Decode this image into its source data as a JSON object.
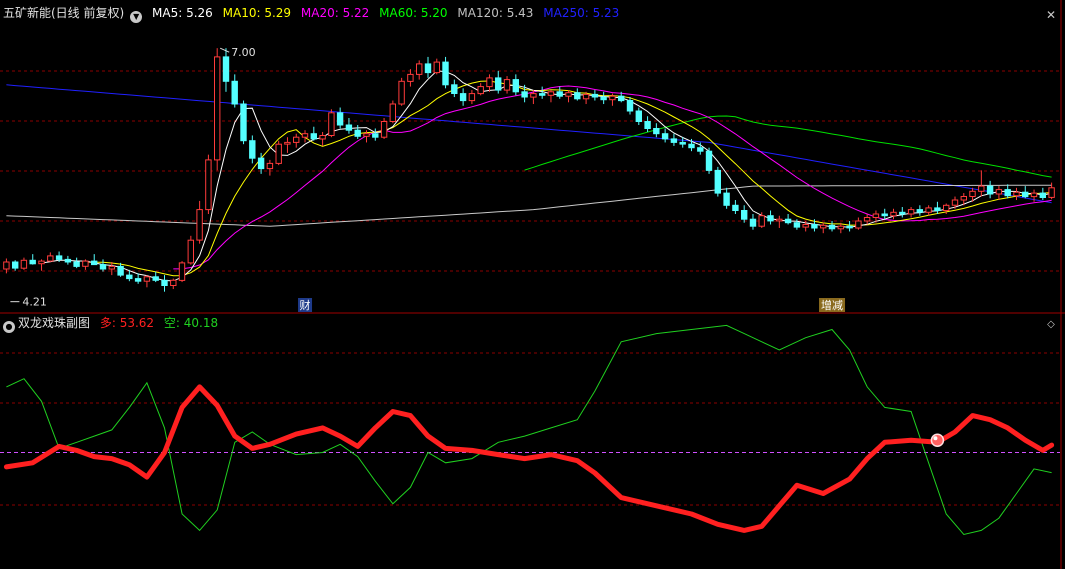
{
  "main_panel": {
    "title": "五矿新能(日线 前复权)",
    "ma_legend": [
      {
        "label": "MA5: 5.26",
        "color": "#ffffff"
      },
      {
        "label": "MA10: 5.29",
        "color": "#ffff00"
      },
      {
        "label": "MA20: 5.22",
        "color": "#ff00ff"
      },
      {
        "label": "MA60: 5.20",
        "color": "#00ff00"
      },
      {
        "label": "MA120: 5.43",
        "color": "#c0c0c0"
      },
      {
        "label": "MA250: 5.23",
        "color": "#0000ff"
      }
    ],
    "high_label": "7.00",
    "low_label": "4.21",
    "markers": [
      {
        "text": "财",
        "color": "#ffffff",
        "bg": "#1e3a8a"
      },
      {
        "text": "增减",
        "color": "#ffffff",
        "bg": "#8a6a1e"
      }
    ]
  },
  "sub_panel": {
    "title": "双龙戏珠副图",
    "series_labels": [
      {
        "label": "多: 53.62",
        "color": "#ff2020"
      },
      {
        "label": "空: 40.18",
        "color": "#20d020"
      }
    ]
  },
  "colors": {
    "up": "#ff3b3b",
    "down": "#54ffff",
    "grid": "#8b0000",
    "bg": "#000000"
  },
  "icons": {
    "close": "close-icon",
    "expand": "expand-icon",
    "dropdown": "chevron-down-icon"
  },
  "chart_data": [
    {
      "type": "candlestick",
      "title": "五矿新能(日线 前复权)",
      "ylim": [
        4.0,
        7.3
      ],
      "annotations": [
        {
          "text": "7.00",
          "value": 7.0
        },
        {
          "text": "4.21",
          "value": 4.21
        }
      ],
      "candles": [
        [
          4.47,
          4.59,
          4.42,
          4.55
        ],
        [
          4.55,
          4.57,
          4.45,
          4.48
        ],
        [
          4.48,
          4.6,
          4.46,
          4.57
        ],
        [
          4.57,
          4.64,
          4.52,
          4.53
        ],
        [
          4.53,
          4.58,
          4.45,
          4.56
        ],
        [
          4.56,
          4.66,
          4.55,
          4.62
        ],
        [
          4.62,
          4.67,
          4.55,
          4.58
        ],
        [
          4.58,
          4.62,
          4.52,
          4.55
        ],
        [
          4.55,
          4.6,
          4.48,
          4.5
        ],
        [
          4.5,
          4.58,
          4.46,
          4.56
        ],
        [
          4.56,
          4.64,
          4.52,
          4.52
        ],
        [
          4.52,
          4.58,
          4.44,
          4.47
        ],
        [
          4.47,
          4.55,
          4.4,
          4.5
        ],
        [
          4.5,
          4.54,
          4.38,
          4.4
        ],
        [
          4.4,
          4.46,
          4.33,
          4.36
        ],
        [
          4.36,
          4.42,
          4.3,
          4.33
        ],
        [
          4.33,
          4.4,
          4.26,
          4.38
        ],
        [
          4.38,
          4.44,
          4.32,
          4.34
        ],
        [
          4.34,
          4.4,
          4.21,
          4.28
        ],
        [
          4.28,
          4.36,
          4.24,
          4.34
        ],
        [
          4.34,
          4.56,
          4.32,
          4.54
        ],
        [
          4.54,
          4.85,
          4.52,
          4.8
        ],
        [
          4.8,
          5.25,
          4.76,
          5.15
        ],
        [
          5.15,
          5.78,
          5.1,
          5.72
        ],
        [
          5.72,
          7.0,
          5.6,
          6.9
        ],
        [
          6.9,
          7.0,
          6.5,
          6.62
        ],
        [
          6.62,
          6.7,
          6.32,
          6.36
        ],
        [
          6.36,
          6.4,
          5.9,
          5.94
        ],
        [
          5.94,
          6.0,
          5.68,
          5.74
        ],
        [
          5.74,
          5.8,
          5.56,
          5.62
        ],
        [
          5.62,
          5.72,
          5.54,
          5.68
        ],
        [
          5.68,
          5.94,
          5.66,
          5.9
        ],
        [
          5.9,
          5.98,
          5.8,
          5.92
        ],
        [
          5.92,
          6.02,
          5.86,
          5.98
        ],
        [
          5.98,
          6.06,
          5.92,
          6.02
        ],
        [
          6.02,
          6.1,
          5.94,
          5.96
        ],
        [
          5.96,
          6.04,
          5.88,
          6.0
        ],
        [
          6.0,
          6.3,
          5.98,
          6.26
        ],
        [
          6.26,
          6.32,
          6.08,
          6.12
        ],
        [
          6.12,
          6.2,
          6.02,
          6.06
        ],
        [
          6.06,
          6.12,
          5.96,
          5.99
        ],
        [
          5.99,
          6.06,
          5.92,
          6.02
        ],
        [
          6.02,
          6.08,
          5.94,
          5.98
        ],
        [
          5.98,
          6.2,
          5.96,
          6.16
        ],
        [
          6.16,
          6.4,
          6.14,
          6.36
        ],
        [
          6.36,
          6.66,
          6.34,
          6.62
        ],
        [
          6.62,
          6.76,
          6.56,
          6.7
        ],
        [
          6.7,
          6.86,
          6.64,
          6.82
        ],
        [
          6.82,
          6.9,
          6.66,
          6.72
        ],
        [
          6.72,
          6.88,
          6.7,
          6.84
        ],
        [
          6.84,
          6.9,
          6.54,
          6.58
        ],
        [
          6.58,
          6.64,
          6.44,
          6.48
        ],
        [
          6.48,
          6.54,
          6.34,
          6.4
        ],
        [
          6.4,
          6.52,
          6.36,
          6.48
        ],
        [
          6.48,
          6.6,
          6.46,
          6.56
        ],
        [
          6.56,
          6.7,
          6.5,
          6.66
        ],
        [
          6.66,
          6.74,
          6.48,
          6.52
        ],
        [
          6.52,
          6.68,
          6.48,
          6.64
        ],
        [
          6.64,
          6.7,
          6.46,
          6.5
        ],
        [
          6.5,
          6.58,
          6.38,
          6.44
        ],
        [
          6.44,
          6.52,
          6.36,
          6.48
        ],
        [
          6.48,
          6.56,
          6.42,
          6.46
        ],
        [
          6.46,
          6.52,
          6.38,
          6.5
        ],
        [
          6.5,
          6.56,
          6.42,
          6.45
        ],
        [
          6.45,
          6.52,
          6.38,
          6.49
        ],
        [
          6.49,
          6.54,
          6.4,
          6.42
        ],
        [
          6.42,
          6.5,
          6.36,
          6.47
        ],
        [
          6.47,
          6.52,
          6.4,
          6.44
        ],
        [
          6.44,
          6.5,
          6.36,
          6.41
        ],
        [
          6.41,
          6.48,
          6.34,
          6.45
        ],
        [
          6.45,
          6.5,
          6.38,
          6.4
        ],
        [
          6.4,
          6.44,
          6.24,
          6.28
        ],
        [
          6.28,
          6.32,
          6.12,
          6.16
        ],
        [
          6.16,
          6.22,
          6.04,
          6.08
        ],
        [
          6.08,
          6.14,
          5.98,
          6.02
        ],
        [
          6.02,
          6.08,
          5.92,
          5.96
        ],
        [
          5.96,
          6.02,
          5.88,
          5.92
        ],
        [
          5.92,
          5.98,
          5.86,
          5.9
        ],
        [
          5.9,
          5.96,
          5.82,
          5.86
        ],
        [
          5.86,
          5.92,
          5.78,
          5.82
        ],
        [
          5.82,
          5.86,
          5.56,
          5.6
        ],
        [
          5.6,
          5.64,
          5.3,
          5.34
        ],
        [
          5.34,
          5.4,
          5.16,
          5.2
        ],
        [
          5.2,
          5.26,
          5.1,
          5.14
        ],
        [
          5.14,
          5.2,
          5.0,
          5.04
        ],
        [
          5.04,
          5.1,
          4.92,
          4.96
        ],
        [
          4.96,
          5.12,
          4.94,
          5.08
        ],
        [
          5.08,
          5.14,
          4.98,
          5.02
        ],
        [
          5.02,
          5.08,
          4.94,
          5.04
        ],
        [
          5.04,
          5.1,
          4.98,
          5.0
        ],
        [
          5.0,
          5.04,
          4.92,
          4.95
        ],
        [
          4.95,
          5.02,
          4.9,
          4.98
        ],
        [
          4.98,
          5.04,
          4.9,
          4.94
        ],
        [
          4.94,
          5.0,
          4.88,
          4.97
        ],
        [
          4.97,
          5.02,
          4.9,
          4.93
        ],
        [
          4.93,
          5.0,
          4.88,
          4.96
        ],
        [
          4.96,
          5.02,
          4.9,
          4.94
        ],
        [
          4.94,
          5.06,
          4.92,
          5.02
        ],
        [
          5.02,
          5.1,
          4.98,
          5.06
        ],
        [
          5.06,
          5.14,
          5.0,
          5.1
        ],
        [
          5.1,
          5.16,
          5.04,
          5.08
        ],
        [
          5.08,
          5.16,
          5.04,
          5.12
        ],
        [
          5.12,
          5.18,
          5.06,
          5.1
        ],
        [
          5.1,
          5.18,
          5.06,
          5.15
        ],
        [
          5.15,
          5.2,
          5.08,
          5.12
        ],
        [
          5.12,
          5.2,
          5.08,
          5.17
        ],
        [
          5.17,
          5.24,
          5.1,
          5.14
        ],
        [
          5.14,
          5.22,
          5.1,
          5.2
        ],
        [
          5.2,
          5.3,
          5.16,
          5.26
        ],
        [
          5.26,
          5.34,
          5.2,
          5.3
        ],
        [
          5.3,
          5.4,
          5.24,
          5.36
        ],
        [
          5.36,
          5.6,
          5.3,
          5.42
        ],
        [
          5.42,
          5.48,
          5.28,
          5.33
        ],
        [
          5.33,
          5.42,
          5.26,
          5.38
        ],
        [
          5.38,
          5.44,
          5.28,
          5.31
        ],
        [
          5.31,
          5.4,
          5.26,
          5.35
        ],
        [
          5.35,
          5.42,
          5.28,
          5.3
        ],
        [
          5.3,
          5.38,
          5.24,
          5.34
        ],
        [
          5.34,
          5.4,
          5.26,
          5.29
        ],
        [
          5.29,
          5.46,
          5.27,
          5.4
        ]
      ],
      "ma_series": [
        {
          "name": "MA5",
          "last": 5.26,
          "color": "#ffffff"
        },
        {
          "name": "MA10",
          "last": 5.29,
          "color": "#ffff00"
        },
        {
          "name": "MA20",
          "last": 5.22,
          "color": "#ff00ff"
        },
        {
          "name": "MA60",
          "last": 5.2,
          "color": "#00ff00"
        },
        {
          "name": "MA120",
          "last": 5.43,
          "color": "#c0c0c0"
        },
        {
          "name": "MA250",
          "last": 5.23,
          "color": "#0000ff"
        }
      ],
      "ma250_points": [
        [
          0,
          6.58
        ],
        [
          40,
          6.25
        ],
        [
          80,
          5.92
        ],
        [
          119,
          5.23
        ]
      ],
      "ma120_points": [
        [
          0,
          5.08
        ],
        [
          30,
          4.96
        ],
        [
          60,
          5.15
        ],
        [
          85,
          5.42
        ],
        [
          119,
          5.43
        ]
      ],
      "marker_bars": [
        {
          "text": "财",
          "bar": 34
        },
        {
          "text": "增减",
          "bar": 94
        }
      ]
    },
    {
      "type": "line",
      "title": "双龙戏珠副图",
      "ylim": [
        0,
        100
      ],
      "reference_line": 50,
      "series": [
        {
          "name": "多",
          "last": 53.62,
          "color": "#ff2020",
          "points": [
            [
              0,
              43
            ],
            [
              3,
              45
            ],
            [
              6,
              53
            ],
            [
              8,
              51
            ],
            [
              10,
              48
            ],
            [
              12,
              47
            ],
            [
              14,
              44
            ],
            [
              16,
              38
            ],
            [
              18,
              50
            ],
            [
              20,
              72
            ],
            [
              22,
              82
            ],
            [
              24,
              73
            ],
            [
              26,
              58
            ],
            [
              28,
              52
            ],
            [
              30,
              54
            ],
            [
              33,
              59
            ],
            [
              36,
              62
            ],
            [
              38,
              58
            ],
            [
              40,
              53
            ],
            [
              42,
              62
            ],
            [
              44,
              70
            ],
            [
              46,
              68
            ],
            [
              48,
              58
            ],
            [
              50,
              52
            ],
            [
              53,
              51
            ],
            [
              56,
              49
            ],
            [
              59,
              47
            ],
            [
              62,
              49
            ],
            [
              65,
              46
            ],
            [
              67,
              40
            ],
            [
              70,
              28
            ],
            [
              74,
              24
            ],
            [
              78,
              20
            ],
            [
              81,
              15
            ],
            [
              84,
              12
            ],
            [
              86,
              14
            ],
            [
              88,
              24
            ],
            [
              90,
              34
            ],
            [
              93,
              30
            ],
            [
              96,
              37
            ],
            [
              98,
              47
            ],
            [
              100,
              55
            ],
            [
              103,
              56
            ],
            [
              106,
              55
            ],
            [
              108,
              60
            ],
            [
              110,
              68
            ],
            [
              112,
              66
            ],
            [
              114,
              62
            ],
            [
              116,
              56
            ],
            [
              118,
              51
            ],
            [
              119,
              53.62
            ]
          ]
        },
        {
          "name": "空",
          "last": 40.18,
          "color": "#20d020",
          "points": [
            [
              0,
              82
            ],
            [
              2,
              86
            ],
            [
              4,
              75
            ],
            [
              6,
              52
            ],
            [
              8,
              55
            ],
            [
              10,
              58
            ],
            [
              12,
              61
            ],
            [
              14,
              72
            ],
            [
              16,
              84
            ],
            [
              18,
              62
            ],
            [
              20,
              20
            ],
            [
              22,
              12
            ],
            [
              24,
              22
            ],
            [
              26,
              55
            ],
            [
              28,
              60
            ],
            [
              30,
              54
            ],
            [
              33,
              49
            ],
            [
              36,
              50
            ],
            [
              38,
              54
            ],
            [
              40,
              48
            ],
            [
              42,
              36
            ],
            [
              44,
              25
            ],
            [
              46,
              33
            ],
            [
              48,
              50
            ],
            [
              50,
              45
            ],
            [
              53,
              47
            ],
            [
              56,
              55
            ],
            [
              59,
              58
            ],
            [
              62,
              62
            ],
            [
              65,
              66
            ],
            [
              67,
              80
            ],
            [
              70,
              104
            ],
            [
              74,
              108
            ],
            [
              78,
              110
            ],
            [
              82,
              112
            ],
            [
              84,
              108
            ],
            [
              86,
              104
            ],
            [
              88,
              100
            ],
            [
              91,
              106
            ],
            [
              94,
              110
            ],
            [
              96,
              100
            ],
            [
              98,
              82
            ],
            [
              100,
              72
            ],
            [
              103,
              70
            ],
            [
              105,
              45
            ],
            [
              107,
              20
            ],
            [
              109,
              10
            ],
            [
              111,
              12
            ],
            [
              113,
              18
            ],
            [
              115,
              30
            ],
            [
              117,
              42
            ],
            [
              119,
              40.18
            ]
          ]
        }
      ],
      "dot_bar": 105
    }
  ]
}
